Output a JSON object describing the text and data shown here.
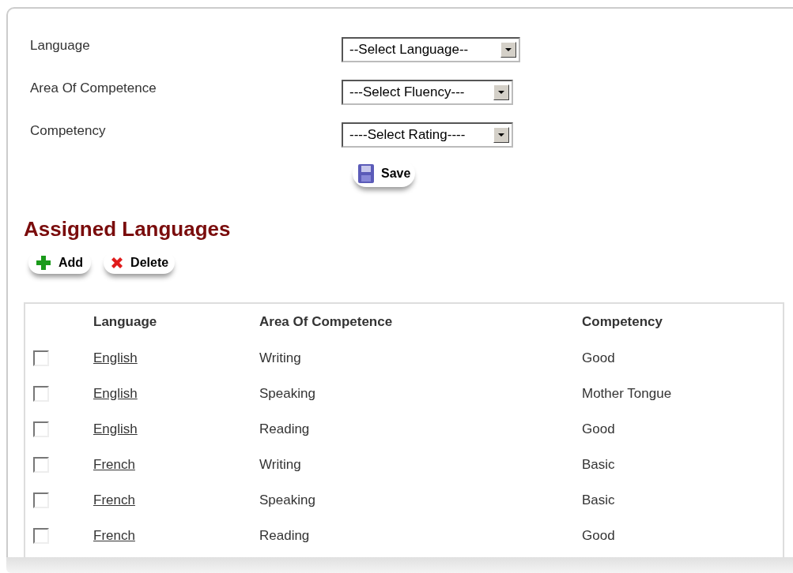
{
  "form": {
    "fields": [
      {
        "label": "Language",
        "value": "--Select Language--"
      },
      {
        "label": "Area Of Competence",
        "value": "---Select Fluency---"
      },
      {
        "label": "Competency",
        "value": "----Select Rating----"
      }
    ],
    "save_button": "Save"
  },
  "section_title": "Assigned Languages",
  "toolbar": {
    "add_button": "Add",
    "delete_button": "Delete"
  },
  "table": {
    "columns": [
      "Language",
      "Area Of Competence",
      "Competency"
    ],
    "rows": [
      {
        "checked": false,
        "cells": [
          "English",
          "Writing",
          "Good"
        ]
      },
      {
        "checked": false,
        "cells": [
          "English",
          "Speaking",
          "Mother Tongue"
        ]
      },
      {
        "checked": false,
        "cells": [
          "English",
          "Reading",
          "Good"
        ]
      },
      {
        "checked": false,
        "cells": [
          "French",
          "Writing",
          "Basic"
        ]
      },
      {
        "checked": false,
        "cells": [
          "French",
          "Speaking",
          "Basic"
        ]
      },
      {
        "checked": false,
        "cells": [
          "French",
          "Reading",
          "Good"
        ]
      }
    ]
  }
}
